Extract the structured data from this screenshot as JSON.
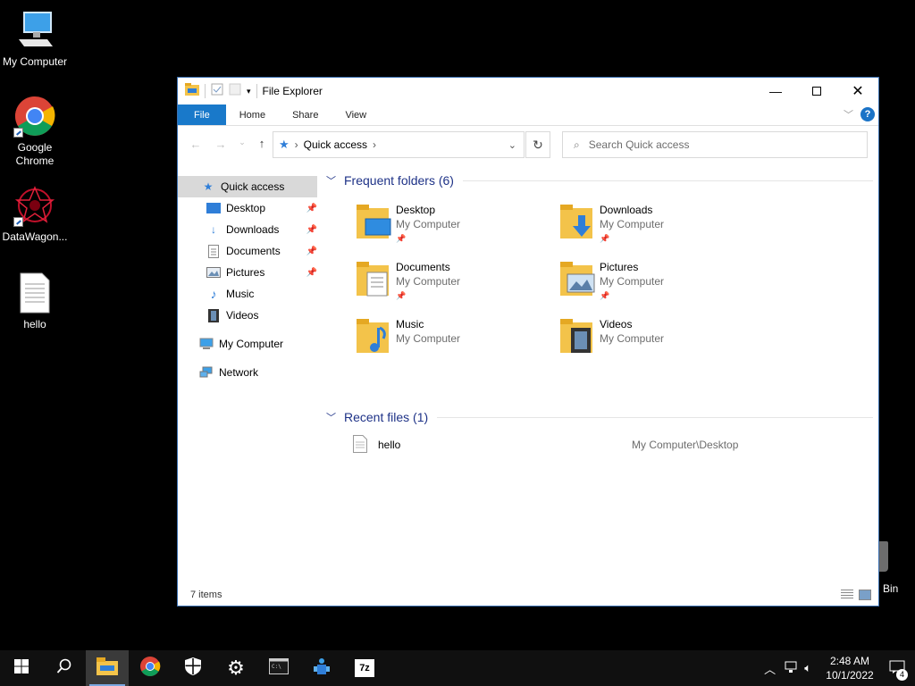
{
  "desktop": {
    "icons": [
      {
        "label": "My Computer"
      },
      {
        "label": "Google\nChrome"
      },
      {
        "label": "DataWagon..."
      },
      {
        "label": "hello"
      }
    ],
    "recycle_partial": "Bin"
  },
  "window": {
    "title": "File Explorer",
    "tabs": {
      "file": "File",
      "home": "Home",
      "share": "Share",
      "view": "View"
    },
    "help": "?",
    "address": {
      "root": "Quick access"
    },
    "search": {
      "placeholder": "Search Quick access"
    },
    "nav": {
      "quick_access": "Quick access",
      "items": [
        {
          "label": "Desktop",
          "pinned": true
        },
        {
          "label": "Downloads",
          "pinned": true
        },
        {
          "label": "Documents",
          "pinned": true
        },
        {
          "label": "Pictures",
          "pinned": true
        },
        {
          "label": "Music",
          "pinned": false
        },
        {
          "label": "Videos",
          "pinned": false
        }
      ],
      "my_computer": "My Computer",
      "network": "Network"
    },
    "frequent": {
      "header": "Frequent folders (6)",
      "folders": [
        {
          "name": "Desktop",
          "location": "My Computer",
          "pinned": true
        },
        {
          "name": "Downloads",
          "location": "My Computer",
          "pinned": true
        },
        {
          "name": "Documents",
          "location": "My Computer",
          "pinned": true
        },
        {
          "name": "Pictures",
          "location": "My Computer",
          "pinned": true
        },
        {
          "name": "Music",
          "location": "My Computer",
          "pinned": false
        },
        {
          "name": "Videos",
          "location": "My Computer",
          "pinned": false
        }
      ]
    },
    "recent": {
      "header": "Recent files (1)",
      "files": [
        {
          "name": "hello",
          "path": "My Computer\\Desktop"
        }
      ]
    },
    "status": "7 items"
  },
  "taskbar": {
    "clock_time": "2:48 AM",
    "clock_date": "10/1/2022",
    "notification_count": "4",
    "apps": [
      "start-icon",
      "search-icon",
      "file-explorer-icon",
      "chrome-icon",
      "security-icon",
      "settings-icon",
      "terminal-icon",
      "app-icon",
      "7zip-icon"
    ],
    "sevenzip_label": "7z"
  },
  "colors": {
    "accent": "#1979ca",
    "group_header": "#1e3287",
    "folder": "#f3c34a"
  }
}
